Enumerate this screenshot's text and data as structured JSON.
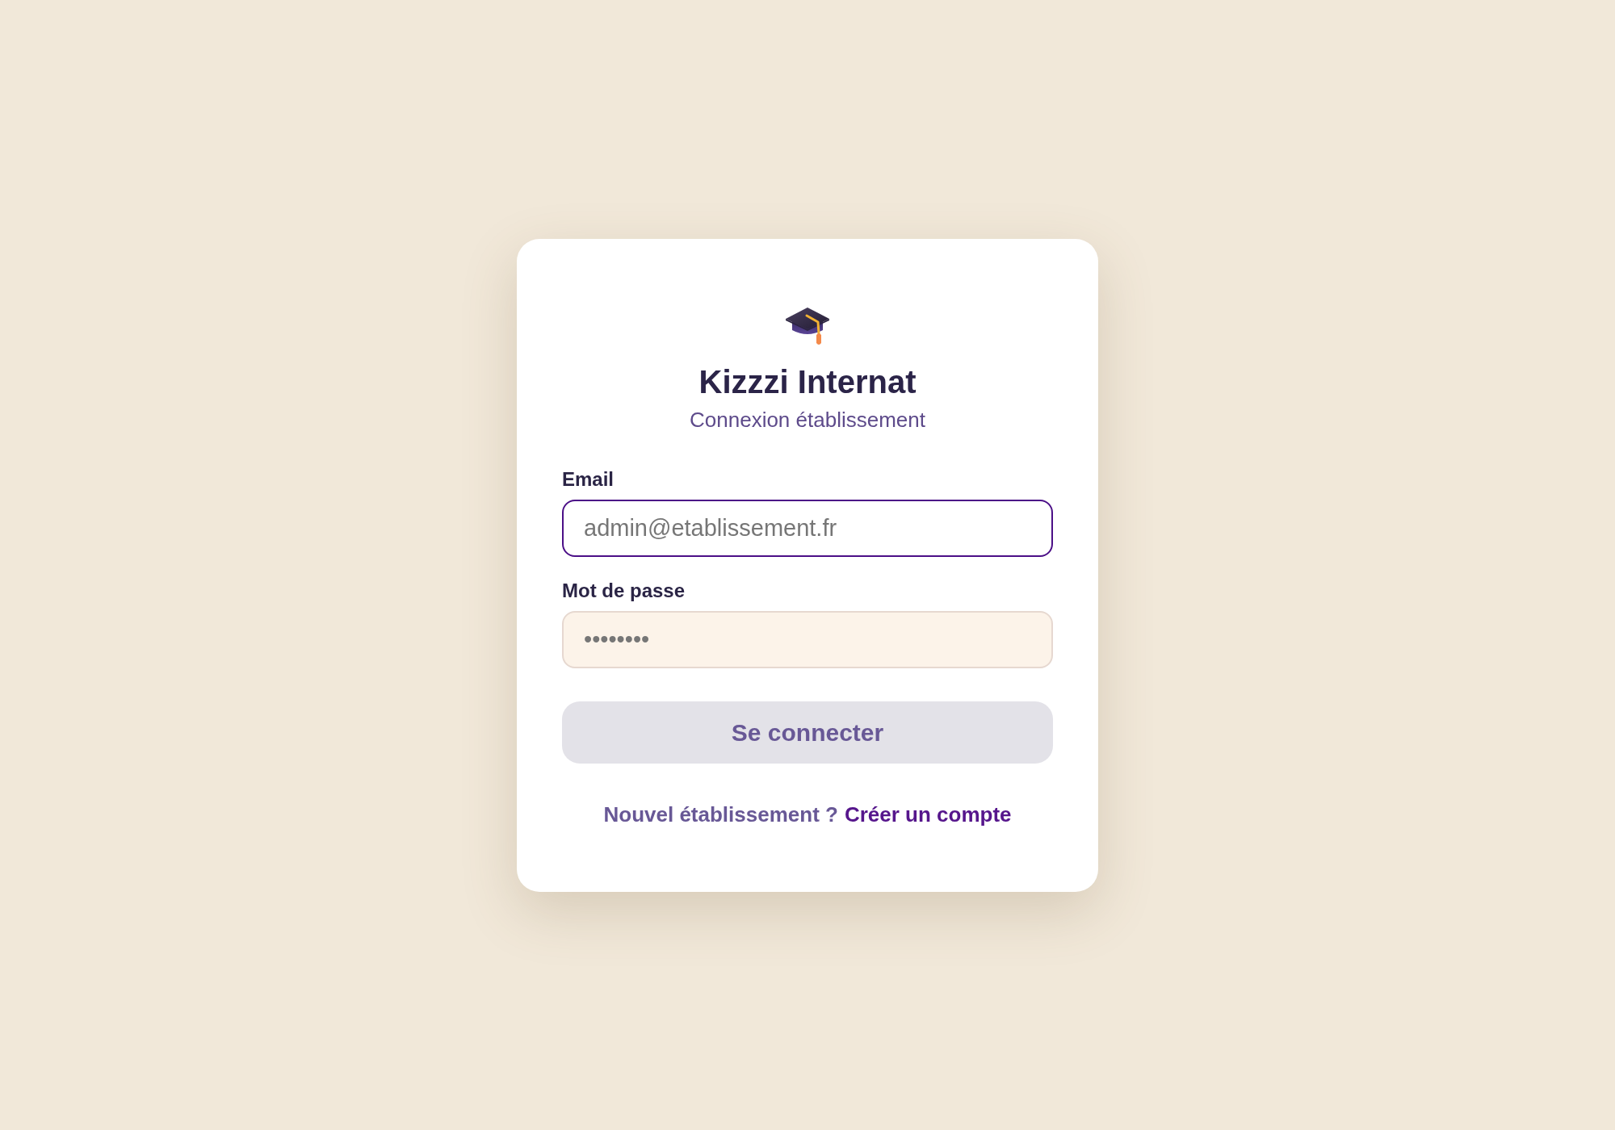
{
  "header": {
    "title": "Kizzzi Internat",
    "subtitle": "Connexion établissement"
  },
  "fields": [
    {
      "label": "Email",
      "placeholder": "admin@etablissement.fr",
      "focused": true
    },
    {
      "label": "Mot de passe",
      "placeholder": "••••••••",
      "focused": false
    }
  ],
  "submit_button": {
    "label": "Se connecter",
    "disabled": true
  },
  "signup": {
    "prompt": "Nouvel établissement ?",
    "link": "Créer un compte"
  }
}
